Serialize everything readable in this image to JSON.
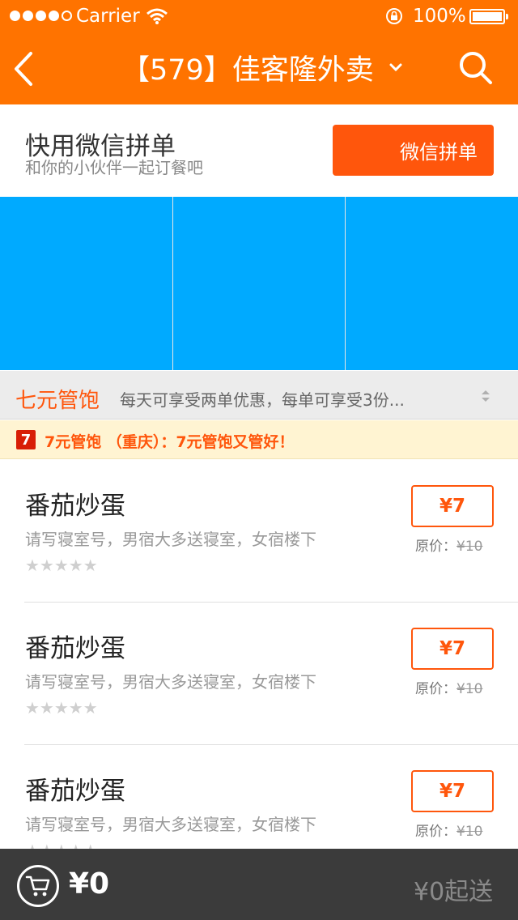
{
  "status_bar": {
    "carrier": "Carrier",
    "battery": "100%"
  },
  "nav": {
    "title": "【579】佳客隆外卖",
    "icons": [
      "back-icon",
      "chevron-down-icon",
      "search-icon"
    ]
  },
  "group_order": {
    "title": "快用微信拼单",
    "subtitle": "和你的小伙伴一起订餐吧",
    "button_label": "微信拼单"
  },
  "banner": {
    "cells": 3,
    "color": "#00aaff"
  },
  "promo": {
    "name": "七元管饱",
    "description": "每天可享受两单优惠，每单可享受3份..."
  },
  "notice": {
    "badge": "7",
    "text": "7元管饱 （重庆）：7元管饱又管好！"
  },
  "items": [
    {
      "name": "番茄炒蛋",
      "description": "请写寝室号，男宿大多送寝室，女宿楼下",
      "stars": "★★★★★",
      "rating": 0,
      "price": "¥7",
      "original_label": "原价：",
      "original_price": "¥10"
    },
    {
      "name": "番茄炒蛋",
      "description": "请写寝室号，男宿大多送寝室，女宿楼下",
      "stars": "★★★★★",
      "rating": 0,
      "price": "¥7",
      "original_label": "原价：",
      "original_price": "¥10"
    },
    {
      "name": "番茄炒蛋",
      "description": "请写寝室号，男宿大多送寝室，女宿楼下",
      "stars": "★★★★★",
      "rating": 0,
      "price": "¥7",
      "original_label": "原价：",
      "original_price": "¥10"
    }
  ],
  "cart": {
    "total": "¥0",
    "min_order": "¥0起送"
  },
  "colors": {
    "brand_orange": "#ff7300",
    "accent_red_orange": "#ff560c",
    "banner_blue": "#00aaff",
    "cart_bar": "#3b3b3b"
  }
}
